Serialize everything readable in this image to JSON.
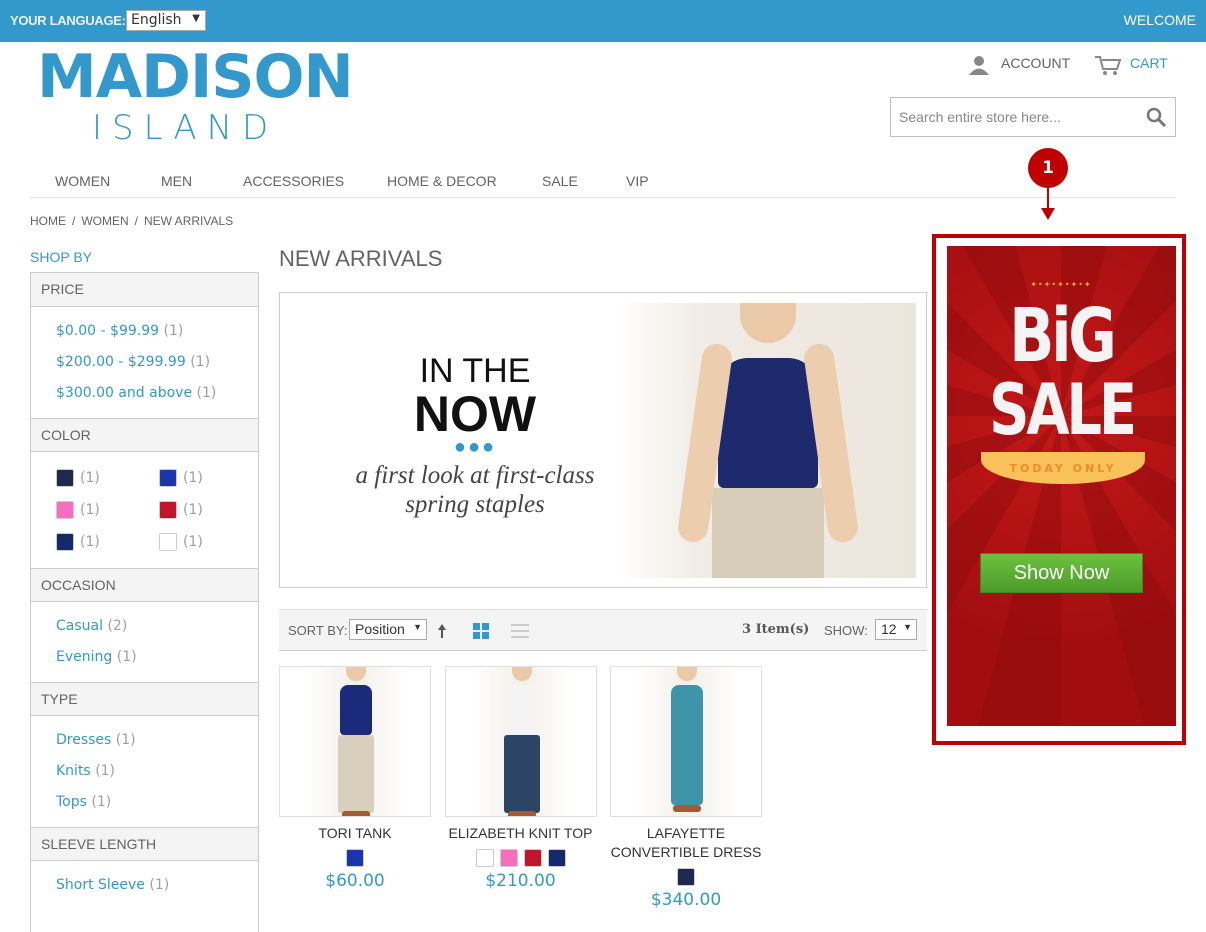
{
  "topbar": {
    "language_label": "YOUR LANGUAGE:",
    "language_value": "English",
    "welcome": "WELCOME"
  },
  "logo": {
    "line1": "MADISON",
    "line2": "ISLAND"
  },
  "header": {
    "account": "ACCOUNT",
    "cart": "CART",
    "search_placeholder": "Search entire store here..."
  },
  "nav": [
    "WOMEN",
    "MEN",
    "ACCESSORIES",
    "HOME & DECOR",
    "SALE",
    "VIP"
  ],
  "breadcrumb": [
    "HOME",
    "/",
    "WOMEN",
    "/",
    "NEW ARRIVALS"
  ],
  "sidebar": {
    "title": "SHOP BY",
    "price": {
      "label": "PRICE",
      "items": [
        {
          "label": "$0.00 - $99.99",
          "count": "(1)"
        },
        {
          "label": "$200.00 - $299.99",
          "count": "(1)"
        },
        {
          "label": "$300.00 and above",
          "count": "(1)"
        }
      ]
    },
    "color": {
      "label": "COLOR",
      "items": [
        {
          "color": "#1f2950",
          "count": "(1)"
        },
        {
          "color": "#1a36ad",
          "count": "(1)"
        },
        {
          "color": "#f56ec0",
          "count": "(1)"
        },
        {
          "color": "#c0152a",
          "count": "(1)"
        },
        {
          "color": "#13296b",
          "count": "(1)"
        },
        {
          "color": "#ffffff",
          "count": "(1)"
        }
      ]
    },
    "occasion": {
      "label": "OCCASION",
      "items": [
        {
          "label": "Casual",
          "count": "(2)"
        },
        {
          "label": "Evening",
          "count": "(1)"
        }
      ]
    },
    "type": {
      "label": "TYPE",
      "items": [
        {
          "label": "Dresses",
          "count": "(1)"
        },
        {
          "label": "Knits",
          "count": "(1)"
        },
        {
          "label": "Tops",
          "count": "(1)"
        }
      ]
    },
    "sleeve": {
      "label": "SLEEVE LENGTH",
      "items": [
        {
          "label": "Short Sleeve",
          "count": "(1)"
        }
      ]
    }
  },
  "main": {
    "title": "NEW ARRIVALS",
    "banner": {
      "line1": "IN THE",
      "line2": "NOW",
      "line3": "a first look at first-class",
      "line4": "spring staples"
    },
    "toolbar": {
      "sort_label": "SORT BY:",
      "sort_value": "Position",
      "count": "3 Item(s)",
      "show_label": "SHOW:",
      "show_value": "12"
    },
    "products": [
      {
        "name": "TORI TANK",
        "price": "$60.00",
        "swatches": [
          "#1a36ad"
        ],
        "top": "#1b2a7a",
        "bottom": "#d9cfbd"
      },
      {
        "name": "ELIZABETH KNIT TOP",
        "price": "$210.00",
        "swatches": [
          "#ffffff",
          "#f56ec0",
          "#c0152a",
          "#13296b"
        ],
        "top": "#f4f4f4",
        "bottom": "#2c4466"
      },
      {
        "name": "LAFAYETTE CONVERTIBLE DRESS",
        "price": "$340.00",
        "swatches": [
          "#1f2950"
        ],
        "top": "#3e95a8",
        "bottom": "#3e95a8"
      }
    ]
  },
  "ad": {
    "badge": "1",
    "line1": "BiG",
    "line2": "SALE",
    "ribbon": "TODAY ONLY",
    "button": "Show Now"
  },
  "colors": {
    "brand": "#3399cc",
    "annotation": "#c00000",
    "cta": "#5bb038"
  }
}
